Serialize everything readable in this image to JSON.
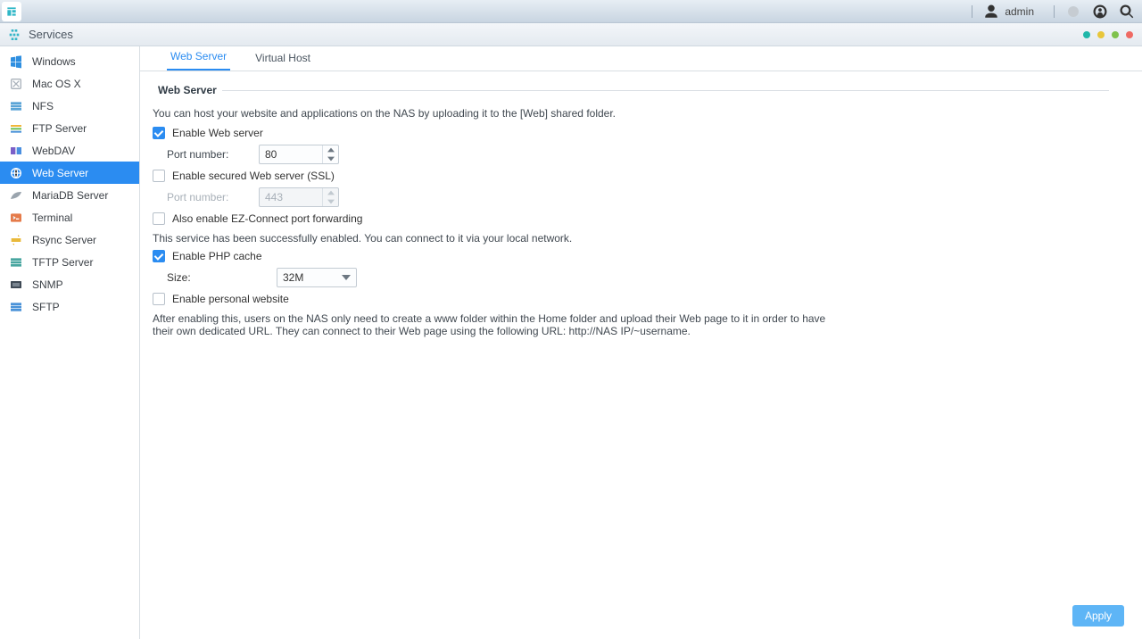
{
  "sysbar": {
    "username": "admin"
  },
  "window": {
    "app_title": "Services"
  },
  "sidebar": {
    "items": [
      {
        "id": "windows",
        "label": "Windows"
      },
      {
        "id": "macos",
        "label": "Mac OS X"
      },
      {
        "id": "nfs",
        "label": "NFS"
      },
      {
        "id": "ftp",
        "label": "FTP Server"
      },
      {
        "id": "webdav",
        "label": "WebDAV"
      },
      {
        "id": "web",
        "label": "Web Server"
      },
      {
        "id": "mariadb",
        "label": "MariaDB Server"
      },
      {
        "id": "terminal",
        "label": "Terminal"
      },
      {
        "id": "rsync",
        "label": "Rsync Server"
      },
      {
        "id": "tftp",
        "label": "TFTP Server"
      },
      {
        "id": "snmp",
        "label": "SNMP"
      },
      {
        "id": "sftp",
        "label": "SFTP"
      }
    ],
    "active_index": 5
  },
  "tabs": {
    "items": [
      {
        "label": "Web Server"
      },
      {
        "label": "Virtual Host"
      }
    ],
    "active_index": 0
  },
  "webserver": {
    "legend": "Web Server",
    "desc": "You can host your website and applications on the NAS by uploading it to the [Web] shared folder.",
    "enable_label": "Enable Web server",
    "enable_checked": true,
    "port_label": "Port number:",
    "port_value": "80",
    "ssl_label": "Enable secured Web server (SSL)",
    "ssl_checked": false,
    "ssl_port_label": "Port number:",
    "ssl_port_value": "443",
    "ez_label": "Also enable EZ-Connect port forwarding",
    "ez_checked": false,
    "status_msg": "This service has been successfully enabled. You can connect to it via your local network.",
    "phpcache_label": "Enable PHP cache",
    "phpcache_checked": true,
    "size_label": "Size:",
    "size_value": "32M",
    "personal_label": "Enable personal website",
    "personal_checked": false,
    "personal_desc": "After enabling this, users on the NAS only need to create a www folder within the Home folder and upload their Web page to it in order to have their own dedicated URL. They can connect to their Web page using the following URL: http://NAS IP/~username."
  },
  "buttons": {
    "apply": "Apply"
  }
}
